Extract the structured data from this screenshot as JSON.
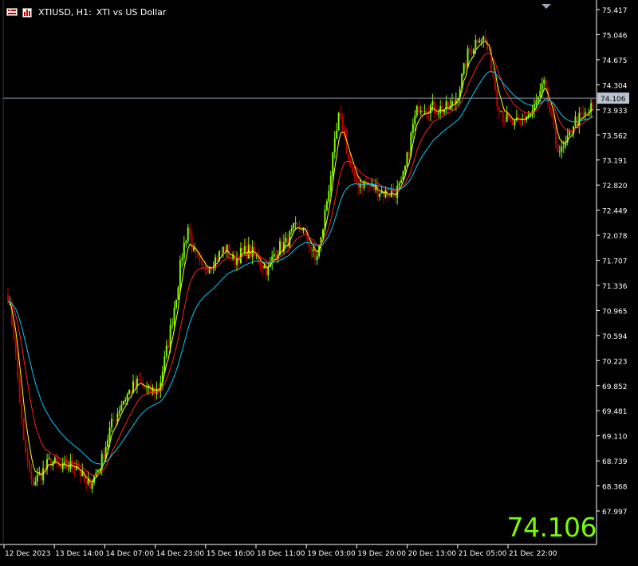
{
  "header": {
    "symbol": "XTIUSD, H1:",
    "description": "XTI vs US Dollar"
  },
  "current_price": "74.106",
  "colors": {
    "background": "#000000",
    "bull_candle": "#7cfc00",
    "bear_candle": "#c00000",
    "axis": "#ffffff",
    "ma_fast": "#ffff00",
    "ma_mid": "#ff2020",
    "ma_slow": "#00ccff",
    "price_line": "#8899aa"
  },
  "icons": [
    "chart-window-icon",
    "indicators-icon"
  ],
  "chart_data": {
    "type": "candlestick",
    "timeframe": "H1",
    "ylim": [
      67.75,
      75.55
    ],
    "price_ticks": [
      "75.417",
      "75.046",
      "74.675",
      "74.304",
      "73.933",
      "73.562",
      "73.191",
      "72.820",
      "72.449",
      "72.078",
      "71.707",
      "71.336",
      "70.965",
      "70.594",
      "70.223",
      "69.852",
      "69.481",
      "69.110",
      "68.739",
      "68.368",
      "67.997"
    ],
    "time_labels": [
      "12 Dec 2023",
      "13 Dec 14:00",
      "14 Dec 07:00",
      "14 Dec 23:00",
      "15 Dec 16:00",
      "18 Dec 11:00",
      "19 Dec 03:00",
      "19 Dec 20:00",
      "20 Dec 13:00",
      "21 Dec 05:00",
      "21 Dec 22:00"
    ],
    "current_price": 74.106,
    "close_path": [
      [
        0,
        71.2
      ],
      [
        3,
        70.6
      ],
      [
        8,
        69.0
      ],
      [
        12,
        68.4
      ],
      [
        17,
        68.55
      ],
      [
        22,
        68.75
      ],
      [
        27,
        68.6
      ],
      [
        30,
        68.65
      ],
      [
        35,
        68.7
      ],
      [
        40,
        68.35
      ],
      [
        44,
        68.5
      ],
      [
        48,
        68.75
      ],
      [
        52,
        69.2
      ],
      [
        58,
        69.6
      ],
      [
        63,
        69.8
      ],
      [
        67,
        69.9
      ],
      [
        72,
        69.75
      ],
      [
        77,
        69.8
      ],
      [
        82,
        70.5
      ],
      [
        86,
        71.2
      ],
      [
        89,
        71.8
      ],
      [
        92,
        72.2
      ],
      [
        95,
        71.8
      ],
      [
        99,
        71.55
      ],
      [
        103,
        71.65
      ],
      [
        107,
        71.75
      ],
      [
        111,
        71.9
      ],
      [
        115,
        71.7
      ],
      [
        119,
        71.8
      ],
      [
        123,
        71.85
      ],
      [
        127,
        71.75
      ],
      [
        130,
        71.65
      ],
      [
        133,
        71.55
      ],
      [
        136,
        71.8
      ],
      [
        139,
        71.9
      ],
      [
        142,
        71.95
      ],
      [
        146,
        72.15
      ],
      [
        150,
        72.2
      ],
      [
        154,
        71.95
      ],
      [
        157,
        71.7
      ],
      [
        160,
        72.0
      ],
      [
        163,
        72.6
      ],
      [
        166,
        73.2
      ],
      [
        169,
        73.8
      ],
      [
        171,
        73.7
      ],
      [
        174,
        73.2
      ],
      [
        177,
        72.85
      ],
      [
        181,
        72.85
      ],
      [
        185,
        72.8
      ],
      [
        189,
        72.75
      ],
      [
        193,
        72.7
      ],
      [
        197,
        72.7
      ],
      [
        201,
        72.8
      ],
      [
        204,
        73.2
      ],
      [
        207,
        73.7
      ],
      [
        210,
        74.0
      ],
      [
        214,
        74.0
      ],
      [
        218,
        73.95
      ],
      [
        222,
        73.95
      ],
      [
        226,
        73.95
      ],
      [
        229,
        74.1
      ],
      [
        232,
        74.4
      ],
      [
        235,
        74.75
      ],
      [
        238,
        74.9
      ],
      [
        241,
        75.05
      ],
      [
        244,
        74.95
      ],
      [
        247,
        74.6
      ],
      [
        250,
        74.1
      ],
      [
        253,
        73.85
      ],
      [
        256,
        73.75
      ],
      [
        259,
        73.7
      ],
      [
        262,
        73.75
      ],
      [
        265,
        73.85
      ],
      [
        268,
        73.9
      ],
      [
        271,
        74.1
      ],
      [
        274,
        74.3
      ],
      [
        277,
        73.9
      ],
      [
        280,
        73.45
      ],
      [
        283,
        73.3
      ],
      [
        286,
        73.45
      ],
      [
        289,
        73.75
      ],
      [
        292,
        73.8
      ],
      [
        295,
        73.85
      ],
      [
        298,
        73.95
      ]
    ],
    "series": [
      {
        "name": "MA fast",
        "color": "#ffff00"
      },
      {
        "name": "MA mid",
        "color": "#ff2020"
      },
      {
        "name": "MA slow",
        "color": "#00ccff"
      }
    ]
  }
}
